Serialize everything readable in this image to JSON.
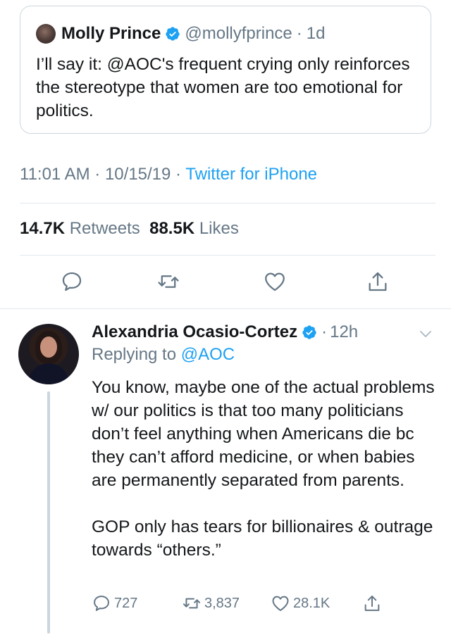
{
  "quoted_tweet": {
    "display_name": "Molly Prince",
    "handle": "@mollyfprince",
    "separator": "·",
    "time": "1d",
    "text": "I’ll say it: @AOC's frequent crying only reinforces the stereotype that women are too emotional for politics."
  },
  "tweet_meta": {
    "time": "11:01 AM",
    "sep1": " · ",
    "date": "10/15/19",
    "sep2": " · ",
    "source": "Twitter for iPhone"
  },
  "stats": {
    "retweets_count": "14.7K",
    "retweets_label": "Retweets",
    "likes_count": "88.5K",
    "likes_label": "Likes"
  },
  "reply": {
    "display_name": "Alexandria Ocasio-Cortez",
    "separator": "·",
    "time": "12h",
    "replying_label": "Replying to",
    "replying_to": "@AOC",
    "paragraph1": "You know, maybe one of the actual problems w/ our politics is that too many politicians don’t feel anything when Americans die bc they can’t afford medicine, or when babies are permanently separated from parents.",
    "paragraph2": "GOP only has tears for billionaires & outrage towards “others.”",
    "reply_count": "727",
    "retweet_count": "3,837",
    "like_count": "28.1K"
  },
  "icons": {
    "verified": "verified-badge-icon",
    "reply": "reply-icon",
    "retweet": "retweet-icon",
    "like": "heart-icon",
    "share": "share-icon",
    "menu": "chevron-down-icon"
  },
  "colors": {
    "accent": "#1da1f2",
    "secondary_text": "#657786",
    "border": "#ccd6dd"
  }
}
